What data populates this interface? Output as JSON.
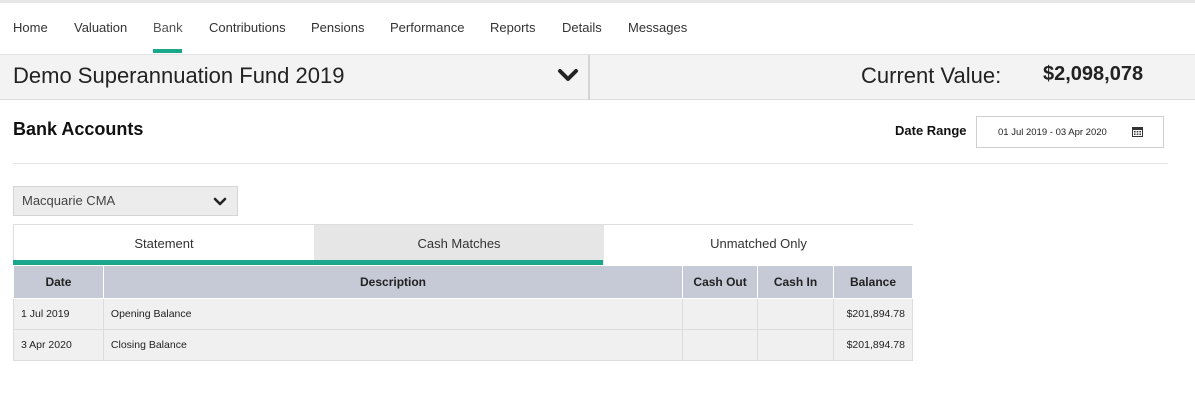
{
  "nav": {
    "items": [
      {
        "label": "Home"
      },
      {
        "label": "Valuation"
      },
      {
        "label": "Bank"
      },
      {
        "label": "Contributions"
      },
      {
        "label": "Pensions"
      },
      {
        "label": "Performance"
      },
      {
        "label": "Reports"
      },
      {
        "label": "Details"
      },
      {
        "label": "Messages"
      }
    ],
    "active": "Bank"
  },
  "fund": {
    "name": "Demo Superannuation Fund 2019",
    "current_value_label": "Current Value:",
    "current_value": "$2,098,078",
    "chevron_icon": "chevron-down-icon"
  },
  "bank": {
    "title": "Bank Accounts",
    "date_range_label": "Date Range",
    "date_range_value": "01 Jul 2019 - 03 Apr 2020",
    "calendar_icon": "calendar-icon",
    "account_selected": "Macquarie CMA"
  },
  "tabs": [
    {
      "label": "Statement",
      "active": true
    },
    {
      "label": "Cash Matches",
      "active": false
    },
    {
      "label": "Unmatched Only",
      "active": false
    }
  ],
  "table": {
    "headers": [
      "Date",
      "Description",
      "Cash Out",
      "Cash In",
      "Balance"
    ],
    "rows": [
      {
        "date": "1 Jul 2019",
        "description": "Opening Balance",
        "cash_out": "",
        "cash_in": "",
        "balance": "$201,894.78"
      },
      {
        "date": "3 Apr 2020",
        "description": "Closing Balance",
        "cash_out": "",
        "cash_in": "",
        "balance": "$201,894.78"
      }
    ]
  },
  "colors": {
    "accent": "#1aa88c",
    "table_header_bg": "#c6c9d6"
  }
}
